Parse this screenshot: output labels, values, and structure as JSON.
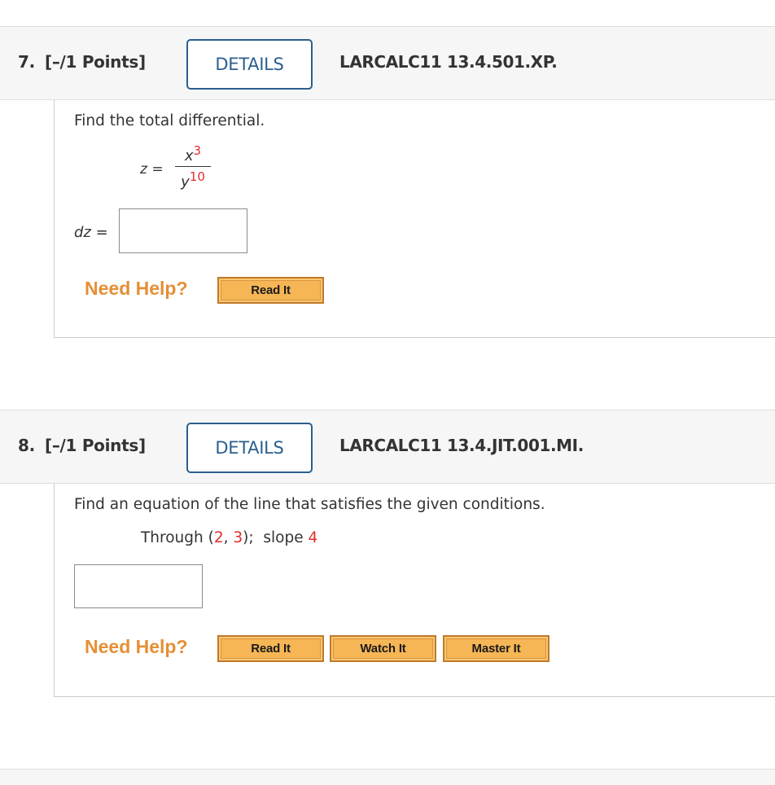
{
  "questions": [
    {
      "number": "7.",
      "points": "[–/1 Points]",
      "details_label": "DETAILS",
      "code": "LARCALC11 13.4.501.XP.",
      "prompt": "Find the total differential.",
      "equation": {
        "lhs": "z =",
        "numerator_base": "x",
        "numerator_exp": "3",
        "denominator_base": "y",
        "denominator_exp": "10"
      },
      "answer_label": "dz =",
      "answer_value": "",
      "need_help": "Need Help?",
      "help_buttons": [
        "Read It"
      ]
    },
    {
      "number": "8.",
      "points": "[–/1 Points]",
      "details_label": "DETAILS",
      "code": "LARCALC11 13.4.JIT.001.MI.",
      "prompt": "Find an equation of the line that satisfies the given conditions.",
      "condition": {
        "through_label": "Through (",
        "x": "2",
        "sep": ", ",
        "y": "3",
        "close": ");",
        "slope_label": "slope",
        "slope": "4"
      },
      "answer_value": "",
      "need_help": "Need Help?",
      "help_buttons": [
        "Read It",
        "Watch It",
        "Master It"
      ]
    }
  ],
  "colors": {
    "details_blue": "#2a5f8f",
    "highlight_red": "#e12d2d",
    "need_help_orange": "#e58f35",
    "help_button_fill": "#f6b656"
  }
}
